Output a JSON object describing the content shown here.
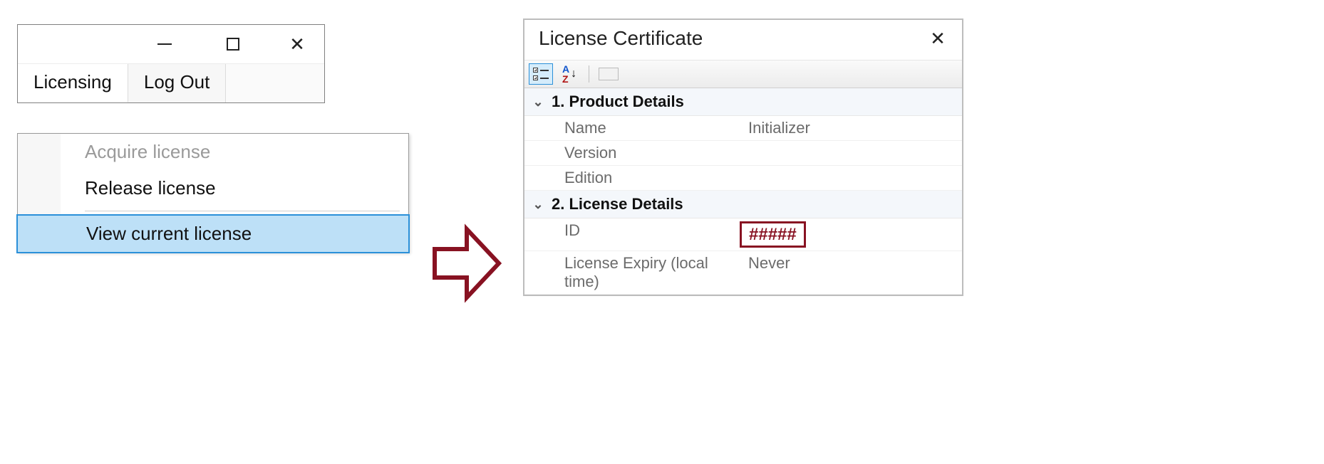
{
  "left": {
    "menu": {
      "licensing_label": "Licensing",
      "logout_label": "Log Out"
    },
    "dropdown": {
      "acquire_label": "Acquire license",
      "release_label": "Release license",
      "view_label": "View current license"
    }
  },
  "dialog": {
    "title": "License Certificate",
    "sections": {
      "product": {
        "header": "1. Product Details",
        "rows": {
          "name_label": "Name",
          "name_value": "Initializer",
          "version_label": "Version",
          "version_value": "",
          "edition_label": "Edition",
          "edition_value": ""
        }
      },
      "license": {
        "header": "2. License Details",
        "rows": {
          "id_label": "ID",
          "id_value": "#####",
          "expiry_label": "License Expiry (local time)",
          "expiry_value": "Never"
        }
      }
    }
  }
}
